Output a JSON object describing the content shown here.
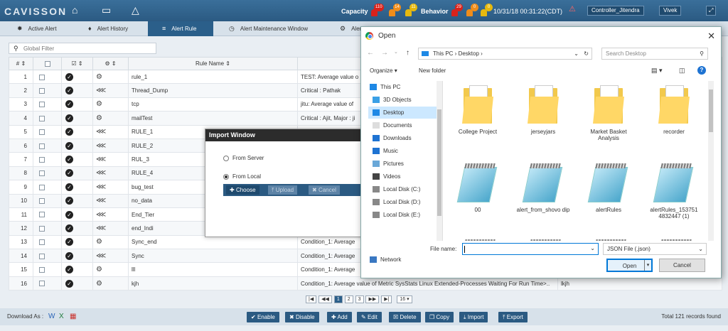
{
  "topbar": {
    "logo": "CAVISSON",
    "capacity_label": "Capacity",
    "behavior_label": "Behavior",
    "capacity_counts": [
      "110",
      "14",
      "11"
    ],
    "behavior_counts": [
      "29",
      "0",
      "0"
    ],
    "datetime": "10/31/18 00:31:22(CDT)",
    "controller": "Controller_Jitendra",
    "user": "Vivek"
  },
  "tabs": [
    {
      "label": "Active Alert",
      "icon": "alert-icon"
    },
    {
      "label": "Alert History",
      "icon": "bell-icon"
    },
    {
      "label": "Alert Rule",
      "icon": "rule-icon"
    },
    {
      "label": "Alert Maintenance Window",
      "icon": "clock-icon"
    },
    {
      "label": "Alert Settings",
      "icon": "gear-icon"
    }
  ],
  "filter": {
    "placeholder": "Global Filter"
  },
  "grid": {
    "col_num": "#",
    "col_rule": "Rule Name",
    "rows": [
      {
        "n": "1",
        "name": "rule_1",
        "cond": "TEST: Average value o"
      },
      {
        "n": "2",
        "name": "Thread_Dump",
        "cond": "Critical : Pathak"
      },
      {
        "n": "3",
        "name": "tcp",
        "cond": "jitu: Average value of"
      },
      {
        "n": "4",
        "name": "mailTest",
        "cond": "Critical : Ajit, Major : ji"
      },
      {
        "n": "5",
        "name": "RULE_1",
        "cond": ""
      },
      {
        "n": "6",
        "name": "RULE_2",
        "cond": ""
      },
      {
        "n": "7",
        "name": "RUL_3",
        "cond": ""
      },
      {
        "n": "8",
        "name": "RULE_4",
        "cond": ""
      },
      {
        "n": "9",
        "name": "bug_test",
        "cond": ""
      },
      {
        "n": "10",
        "name": "no_data",
        "cond": ""
      },
      {
        "n": "11",
        "name": "End_Tier",
        "cond": ""
      },
      {
        "n": "12",
        "name": "end_Indi",
        "cond": ""
      },
      {
        "n": "13",
        "name": "Sync_end",
        "cond": "Condition_1: Average"
      },
      {
        "n": "14",
        "name": "Sync",
        "cond": "Condition_1: Average"
      },
      {
        "n": "15",
        "name": "lll",
        "cond": "Condition_1: Average"
      },
      {
        "n": "16",
        "name": "kjh",
        "cond": "Condition_1: Average value of Metric SysStats Linux Extended-Processes Waiting For Run Time>..",
        "extra": "lkjh"
      }
    ]
  },
  "pager": {
    "pages": [
      "1",
      "2",
      "3"
    ],
    "size": "16"
  },
  "footer": {
    "download_label": "Download As :",
    "total": "Total 121 records found",
    "buttons": [
      "Enable",
      "Disable",
      "Add",
      "Edit",
      "Delete",
      "Copy",
      "Import",
      "Export"
    ]
  },
  "import_window": {
    "title": "Import Window",
    "from_server": "From Server",
    "from_local": "From Local",
    "choose": "Choose",
    "upload": "Upload",
    "cancel": "Cancel"
  },
  "open_dialog": {
    "title": "Open",
    "path_parts": [
      "This PC",
      "Desktop"
    ],
    "search_placeholder": "Search Desktop",
    "organize": "Organize",
    "new_folder": "New folder",
    "nav": [
      "This PC",
      "3D Objects",
      "Desktop",
      "Documents",
      "Downloads",
      "Music",
      "Pictures",
      "Videos",
      "Local Disk (C:)",
      "Local Disk (D:)",
      "Local Disk (E:)",
      "Network"
    ],
    "files": [
      "College Project",
      "jerseyjars",
      "Market Basket Analysis",
      "recorder",
      "00",
      "alert_from_shovo dip",
      "alertRules",
      "alertRules_153751 4832447 (1)"
    ],
    "file_name_label": "File name:",
    "file_name_value": "",
    "file_type": "JSON File (.json)",
    "open": "Open",
    "cancel": "Cancel"
  },
  "colors": {
    "header": "#2b5a82",
    "accent": "#0078d7"
  }
}
